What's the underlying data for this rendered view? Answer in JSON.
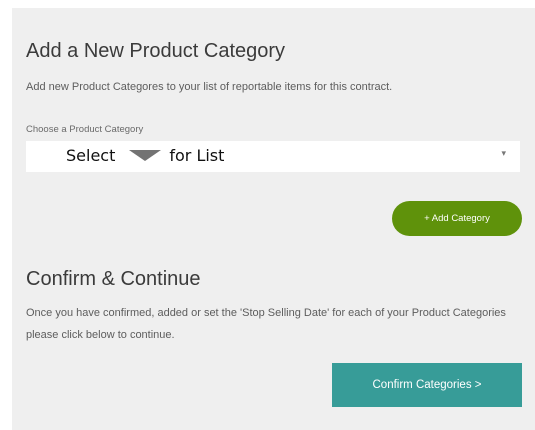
{
  "add_section": {
    "title": "Add a New Product Category",
    "description": "Add new Product Categores to your list of reportable items for this contract.",
    "field_label": "Choose a Product Category",
    "select": {
      "hint_before": "Select",
      "hint_after": "for List",
      "caret": "▾"
    },
    "add_button_label": "+ Add Category"
  },
  "confirm_section": {
    "title": "Confirm & Continue",
    "description": "Once you have confirmed, added or set the 'Stop Selling Date' for each of your Product Categories please click below to continue.",
    "confirm_button_label": "Confirm Categories >"
  },
  "colors": {
    "panel_bg": "#efefef",
    "add_button": "#5f920b",
    "confirm_button": "#379c98"
  },
  "icons": {
    "hint_arrow": "down-triangle-icon",
    "select_caret": "chevron-down-icon"
  }
}
